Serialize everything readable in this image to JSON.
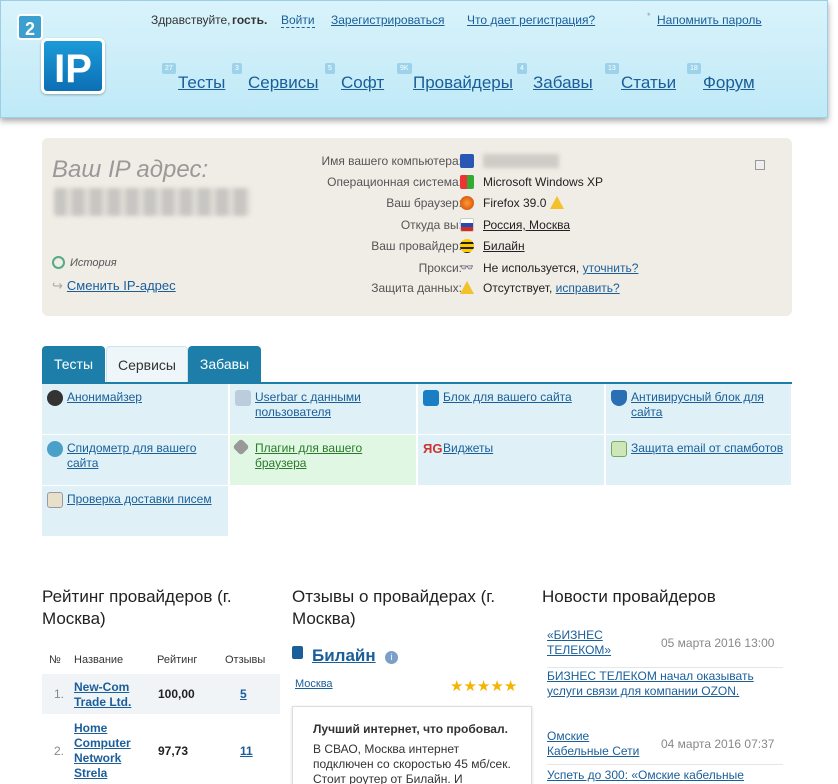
{
  "logo": {
    "badge": "2",
    "text": "IP"
  },
  "topbar": {
    "greeting": "Здравствуйте,",
    "guest": "гость.",
    "login": "Войти",
    "register": "Зарегистрироваться",
    "why_register": "Что дает регистрация?",
    "remind": "Напомнить пароль"
  },
  "nav": [
    {
      "badge": "27",
      "label": "Тесты"
    },
    {
      "badge": "3",
      "label": "Сервисы"
    },
    {
      "badge": "5",
      "label": "Софт"
    },
    {
      "badge": "9K",
      "label": "Провайдеры"
    },
    {
      "badge": "4",
      "label": "Забавы"
    },
    {
      "badge": "13",
      "label": "Статьи"
    },
    {
      "badge": "18",
      "label": "Форум"
    }
  ],
  "ip_panel": {
    "title": "Ваш IP адрес:",
    "history": "История",
    "change_ip": "Сменить IP-адрес",
    "rows": [
      {
        "key": "Имя вашего компьютера:",
        "value": "",
        "icon": "computer-icon"
      },
      {
        "key": "Операционная система:",
        "value": "Microsoft Windows XP",
        "icon": "windows-icon"
      },
      {
        "key": "Ваш браузер:",
        "value": "Firefox 39.0",
        "icon": "firefox-icon"
      },
      {
        "key": "Откуда вы:",
        "value": "Россия, Москва",
        "icon": "russia-flag-icon"
      },
      {
        "key": "Ваш провайдер:",
        "value": "Билайн",
        "icon": "beeline-icon"
      },
      {
        "key": "Прокси:",
        "value": "Не используется,",
        "link": "уточнить?",
        "icon": "glasses-icon"
      },
      {
        "key": "Защита данных:",
        "value": "Отсутствует,",
        "link": "исправить?",
        "icon": "warning-icon"
      }
    ]
  },
  "tabs": [
    "Тесты",
    "Сервисы",
    "Забавы"
  ],
  "services": [
    {
      "label": "Анонимайзер",
      "icon": "mask-icon"
    },
    {
      "label": "Userbar с данными пользователя",
      "icon": "userbar-icon"
    },
    {
      "label": "Блок для вашего сайта",
      "icon": "ip-block-icon"
    },
    {
      "label": "Антивирусный блок для сайта",
      "icon": "shield-icon"
    },
    {
      "label": "Спидометр для вашего сайта",
      "icon": "speedometer-icon"
    },
    {
      "label": "Плагин для вашего браузера",
      "icon": "wrench-icon"
    },
    {
      "label": "Виджеты",
      "icon": "yandex-google-icon"
    },
    {
      "label": "Защита email от спамботов",
      "icon": "envelope-icon"
    },
    {
      "label": "Проверка доставки писем",
      "icon": "mail-check-icon"
    }
  ],
  "rating": {
    "title": "Рейтинг провайдеров (г. Москва)",
    "columns": [
      "№",
      "Название",
      "Рейтинг",
      "Отзывы"
    ],
    "rows": [
      {
        "n": "1.",
        "name": "New-Com Trade Ltd.",
        "rating": "100,00",
        "reviews": "5"
      },
      {
        "n": "2.",
        "name": "Home Computer Network Strela",
        "rating": "97,73",
        "reviews": "11"
      }
    ]
  },
  "reviews": {
    "title": "Отзывы о провайдерах (г. Москва)",
    "provider": "Билайн",
    "city": "Москва",
    "stars": 5,
    "card_title": "Лучший интернет, что пробовал.",
    "card_text": "В СВАО, Москва интернет подключен со скоростью 45 мб/сек. Стоит роутер от Билайн. И"
  },
  "news": {
    "title": "Новости провайдеров",
    "items": [
      {
        "source": "«БИЗНЕС ТЕЛЕКОМ»",
        "date": "05 марта 2016 13:00",
        "text": "БИЗНЕС ТЕЛЕКОМ начал оказывать услуги связи для компании OZON."
      },
      {
        "source": "Омские Кабельные Сети",
        "date": "04 марта 2016 07:37",
        "text": "Успеть до 300: «Омские кабельные"
      }
    ]
  }
}
